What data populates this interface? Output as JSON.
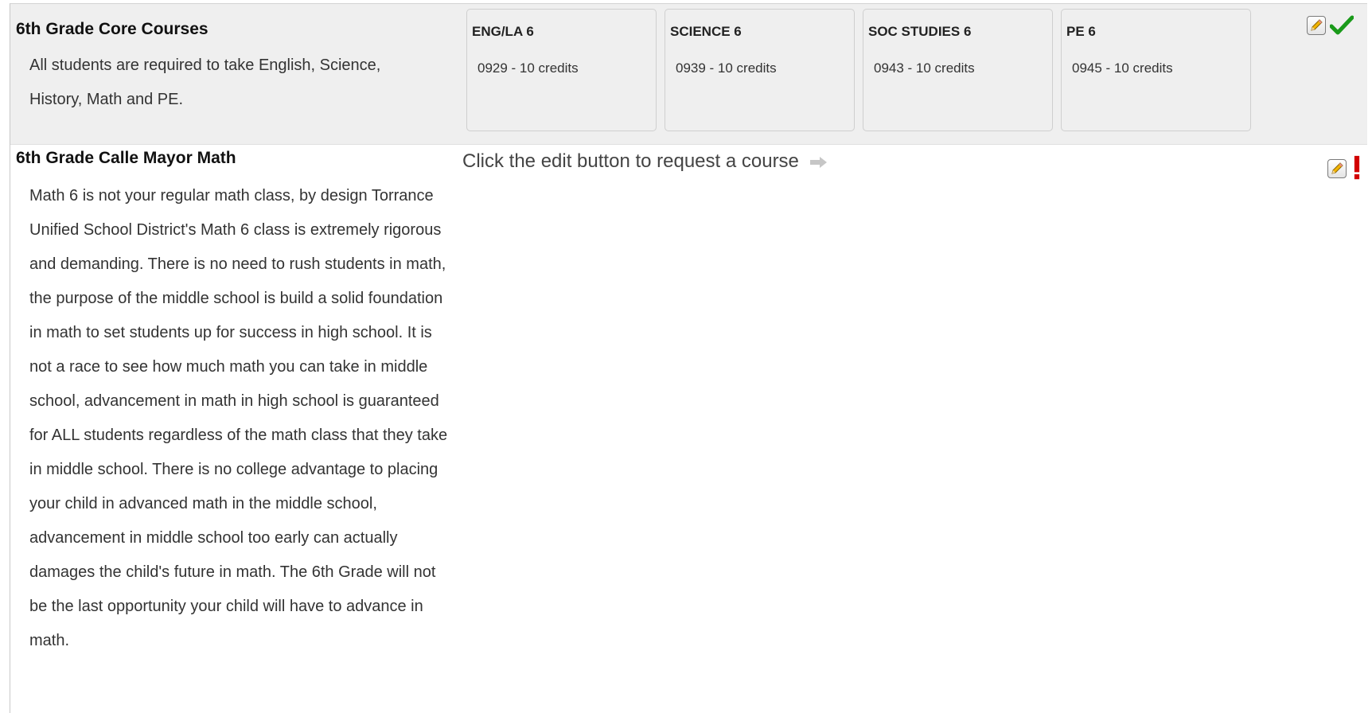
{
  "sections": [
    {
      "title": "6th Grade Core Courses",
      "description": "All students are required to take English, Science, History, Math and PE.",
      "courses": [
        {
          "name": "ENG/LA 6",
          "credits": "0929 - 10 credits"
        },
        {
          "name": "SCIENCE 6",
          "credits": "0939 - 10 credits"
        },
        {
          "name": "SOC STUDIES 6",
          "credits": "0943 - 10 credits"
        },
        {
          "name": "PE 6",
          "credits": "0945 - 10 credits"
        }
      ],
      "status": "complete"
    },
    {
      "title": "6th Grade Calle Mayor Math",
      "description": "Math 6 is not your regular math class, by design Torrance Unified School District's Math 6 class is extremely rigorous and demanding. There is no need to rush students in math, the purpose of the middle school is build a solid foundation in math to set students up for success in high school. It is not a race to see how much math you can take in middle school, advancement in math in high school is guaranteed for ALL students regardless of the math class that they take in middle school. There is no college advantage to placing your child in advanced math in the middle school, advancement in middle school too early can actually damages the child's future in math. The 6th Grade will not be the last opportunity your child will have to advance in math.",
      "prompt": "Click the edit button to request a course",
      "status": "incomplete"
    }
  ],
  "icons": {
    "edit": "pencil-edit-icon",
    "complete": "green-checkmark-icon",
    "incomplete": "red-exclamation-icon",
    "prompt_arrow": "right-arrow-icon"
  },
  "colors": {
    "complete": "#1a9a1a",
    "incomplete": "#d20000",
    "section_bg": "#efefef"
  }
}
